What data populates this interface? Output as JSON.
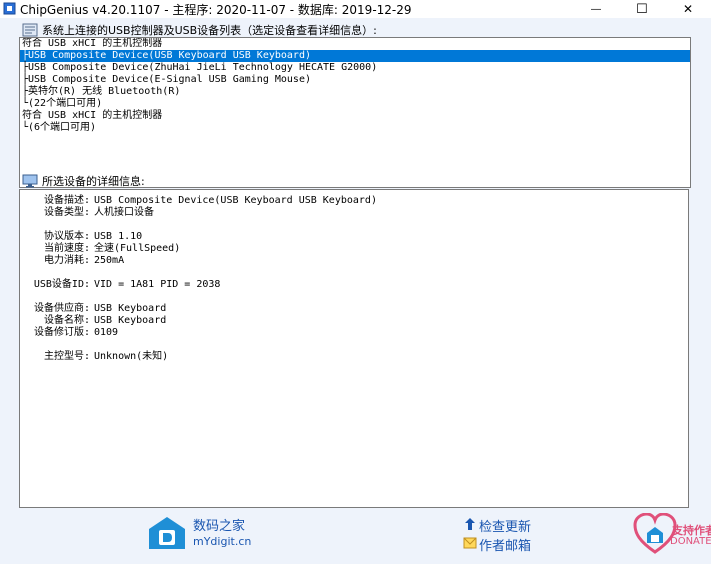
{
  "window": {
    "title": "ChipGenius v4.20.1107 - 主程序: 2020-11-07 - 数据库: 2019-12-29",
    "minimize_glyph": "—",
    "maximize_glyph": "☐",
    "close_glyph": "✕"
  },
  "device_list": {
    "label": "系统上连接的USB控制器及USB设备列表（选定设备查看详细信息）:",
    "items": [
      "符合 USB xHCI 的主机控制器",
      "├USB Composite Device(USB Keyboard USB Keyboard)",
      "├USB Composite Device(ZhuHai JieLi Technology HECATE G2000)",
      "├USB Composite Device(E-Signal USB Gaming Mouse)",
      "├英特尔(R) 无线 Bluetooth(R)",
      "└(22个端口可用)",
      "符合 USB xHCI 的主机控制器",
      "└(6个端口可用)"
    ],
    "selected_index": 1
  },
  "details": {
    "label": "所选设备的详细信息:",
    "rows": [
      {
        "key": "设备描述:",
        "value": "USB Composite Device(USB Keyboard USB Keyboard)"
      },
      {
        "key": "设备类型:",
        "value": "人机接口设备"
      },
      {
        "key": "",
        "value": ""
      },
      {
        "key": "协议版本:",
        "value": "USB 1.10"
      },
      {
        "key": "当前速度:",
        "value": "全速(FullSpeed)"
      },
      {
        "key": "电力消耗:",
        "value": "250mA"
      },
      {
        "key": "",
        "value": ""
      },
      {
        "key": "USB设备ID:",
        "value": "VID = 1A81 PID = 2038"
      },
      {
        "key": "",
        "value": ""
      },
      {
        "key": "设备供应商:",
        "value": "USB Keyboard"
      },
      {
        "key": "设备名称:",
        "value": "USB Keyboard"
      },
      {
        "key": "设备修订版:",
        "value": "0109"
      },
      {
        "key": "",
        "value": ""
      },
      {
        "key": "主控型号:",
        "value": "Unknown(未知)"
      }
    ]
  },
  "footer": {
    "site_name": "数码之家",
    "site_url": "mYdigit.cn",
    "check_update": "检查更新",
    "author_email": "作者邮箱",
    "support_author": "支持作者",
    "donate": "DONATE"
  }
}
